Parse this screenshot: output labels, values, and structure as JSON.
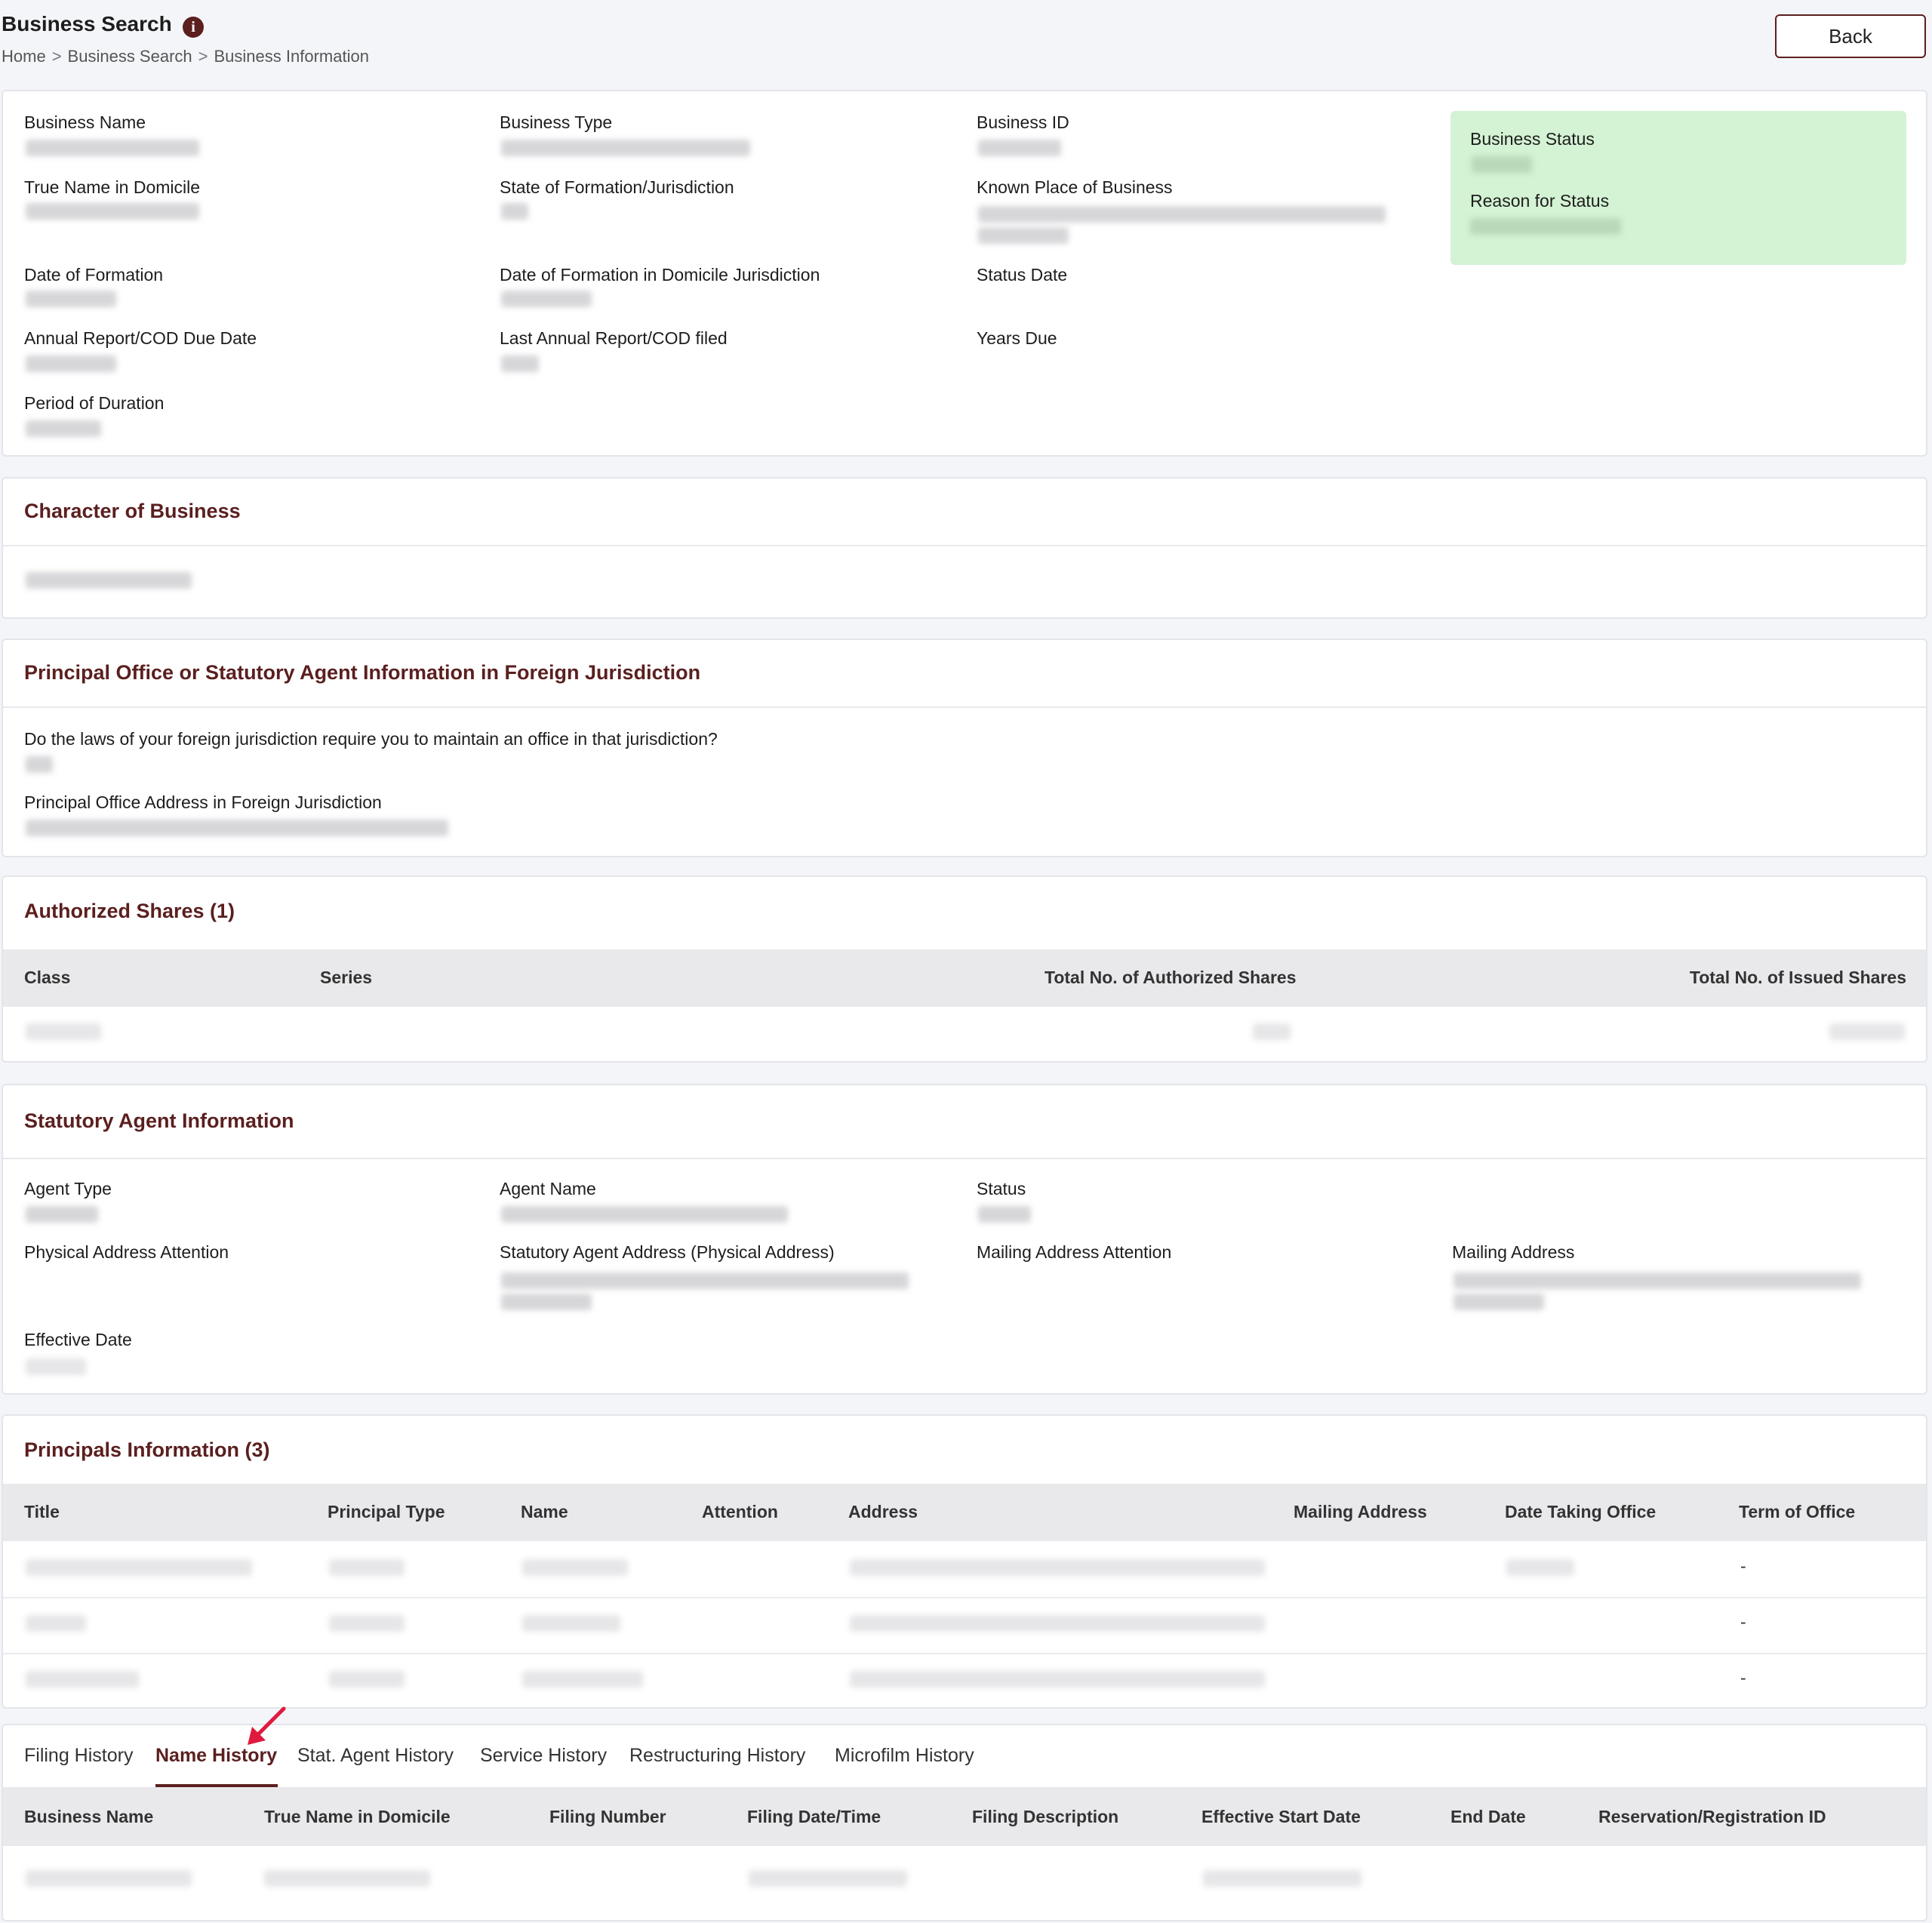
{
  "header": {
    "title": "Business Search",
    "info_icon": "info-icon",
    "breadcrumb": [
      "Home",
      "Business Search",
      "Business Information"
    ],
    "back_label": "Back"
  },
  "business_info": {
    "labels": {
      "business_name": "Business Name",
      "business_type": "Business Type",
      "business_id": "Business ID",
      "true_name": "True Name in Domicile",
      "state_formation": "State of Formation/Jurisdiction",
      "known_place": "Known Place of Business",
      "date_formation": "Date of Formation",
      "date_formation_domicile": "Date of Formation in Domicile Jurisdiction",
      "status_date": "Status Date",
      "annual_report_due": "Annual Report/COD Due Date",
      "last_annual_report": "Last Annual Report/COD filed",
      "years_due": "Years Due",
      "period_duration": "Period of Duration"
    },
    "status_box": {
      "business_status": "Business Status",
      "reason_for_status": "Reason for Status",
      "color": "#d4f2d4"
    }
  },
  "character": {
    "title": "Character of Business"
  },
  "principal_office": {
    "title": "Principal Office or Statutory Agent Information in Foreign Jurisdiction",
    "question": "Do the laws of your foreign jurisdiction require you to maintain an office in that jurisdiction?",
    "address_label": "Principal Office Address in Foreign Jurisdiction"
  },
  "authorized_shares": {
    "title": "Authorized Shares (1)",
    "columns": [
      "Class",
      "Series",
      "Total No. of Authorized Shares",
      "Total No. of Issued Shares"
    ]
  },
  "statutory_agent": {
    "title": "Statutory Agent Information",
    "labels": {
      "agent_type": "Agent Type",
      "agent_name": "Agent Name",
      "status": "Status",
      "physical_attention": "Physical Address Attention",
      "agent_address": "Statutory Agent Address (Physical Address)",
      "mailing_attention": "Mailing Address Attention",
      "mailing_address": "Mailing Address",
      "effective_date": "Effective Date"
    }
  },
  "principals": {
    "title": "Principals Information (3)",
    "columns": [
      "Title",
      "Principal Type",
      "Name",
      "Attention",
      "Address",
      "Mailing Address",
      "Date Taking Office",
      "Term of Office"
    ],
    "term_values": [
      "-",
      "-",
      "-"
    ]
  },
  "history_tabs": {
    "tabs": [
      "Filing History",
      "Name History",
      "Stat. Agent History",
      "Service History",
      "Restructuring History",
      "Microfilm History"
    ],
    "active": "Name History",
    "columns": [
      "Business Name",
      "True Name in Domicile",
      "Filing Number",
      "Filing Date/Time",
      "Filing Description",
      "Effective Start Date",
      "End Date",
      "Reservation/Registration ID"
    ]
  },
  "colors": {
    "accent": "#5b1f1f",
    "arrow": "#e0193f",
    "background": "#f4f5f9"
  }
}
